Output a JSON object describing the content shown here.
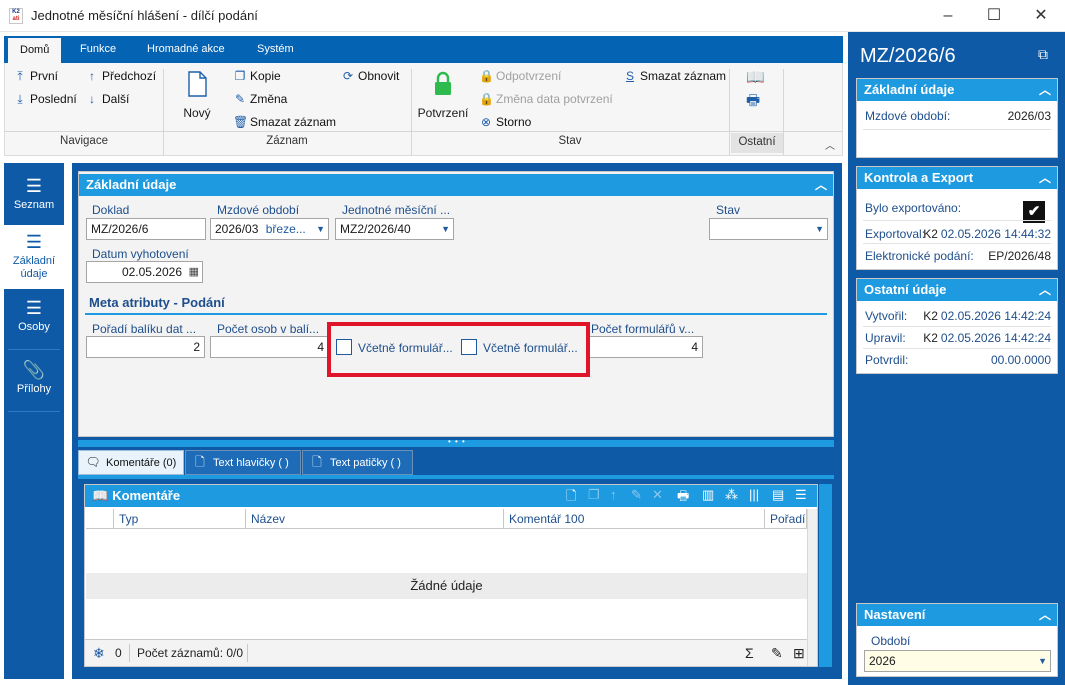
{
  "window": {
    "title": "Jednotné měsíční hlášení - dílčí podání",
    "logo_text_top": "K2",
    "logo_text_bottom": "ati"
  },
  "ribbon": {
    "tabs": [
      "Domů",
      "Funkce",
      "Hromadné akce",
      "Systém"
    ],
    "navigace": {
      "first": "První",
      "previous": "Předchozí",
      "last": "Poslední",
      "next": "Další",
      "label": "Navigace"
    },
    "zaznam": {
      "new": "Nový",
      "copy": "Kopie",
      "change": "Změna",
      "delete": "Smazat záznam",
      "refresh": "Obnovit",
      "label": "Záznam"
    },
    "stav": {
      "confirm": "Potvrzení",
      "unconfirm": "Odpotvrzení",
      "change_date": "Změna data potvrzení",
      "cancel": "Storno",
      "delete": "Smazat záznam",
      "label": "Stav"
    },
    "ostatni": {
      "label": "Ostatní"
    }
  },
  "leftnav": {
    "items": [
      "Seznam",
      "Základní údaje",
      "Osoby",
      "Přílohy"
    ]
  },
  "basic": {
    "header": "Základní údaje",
    "doklad_label": "Doklad",
    "doklad_value": "MZ/2026/6",
    "period_label": "Mzdové období",
    "period_value": "2026/03",
    "period_month": "březe...",
    "jmh_label": "Jednotné měsíční ...",
    "jmh_value": "MZ2/2026/40",
    "stav_label": "Stav",
    "stav_value": "",
    "date_label": "Datum vyhotovení",
    "date_value": "02.05.2026"
  },
  "meta": {
    "header": "Meta atributy - Podání",
    "poradi_label": "Pořadí balíku dat ...",
    "poradi_value": "2",
    "pocet_osob_label": "Počet osob v balí...",
    "pocet_osob_value": "4",
    "vcetne1_label": "Včetně formulář...",
    "vcetne2_label": "Včetně formulář...",
    "pocet_form_label": "Počet formulářů v...",
    "pocet_form_value": "4"
  },
  "lower_tabs": [
    "Komentáře (0)",
    "Text hlavičky ( )",
    "Text patičky ( )"
  ],
  "comments": {
    "header": "Komentáře",
    "columns": [
      "Typ",
      "Název",
      "Komentář 100",
      "Pořadí"
    ],
    "empty": "Žádné údaje",
    "footer_count": "0",
    "footer_records": "Počet záznamů: 0/0"
  },
  "right": {
    "title": "MZ/2026/6",
    "basic": {
      "header": "Základní údaje",
      "period_label": "Mzdové období:",
      "period_value": "2026/03"
    },
    "export": {
      "header": "Kontrola a Export",
      "exported_label": "Bylo exportováno:",
      "exported": true,
      "exportoval_label": "Exportoval:",
      "exportoval_user": "K2",
      "exportoval_time": "02.05.2026 14:44:32",
      "podani_label": "Elektronické podání:",
      "podani_value": "EP/2026/48"
    },
    "other": {
      "header": "Ostatní údaje",
      "created_label": "Vytvořil:",
      "created_user": "K2",
      "created_time": "02.05.2026 14:42:24",
      "modified_label": "Upravil:",
      "modified_user": "K2",
      "modified_time": "02.05.2026 14:42:24",
      "confirmed_label": "Potvrdil:",
      "confirmed_value": "00.00.0000"
    },
    "settings": {
      "header": "Nastavení",
      "period_label": "Období",
      "period_value": "2026"
    }
  },
  "colors": {
    "accent": "#1e9ae0",
    "navy": "#0e5aa7",
    "highlight": "#e0152a"
  }
}
